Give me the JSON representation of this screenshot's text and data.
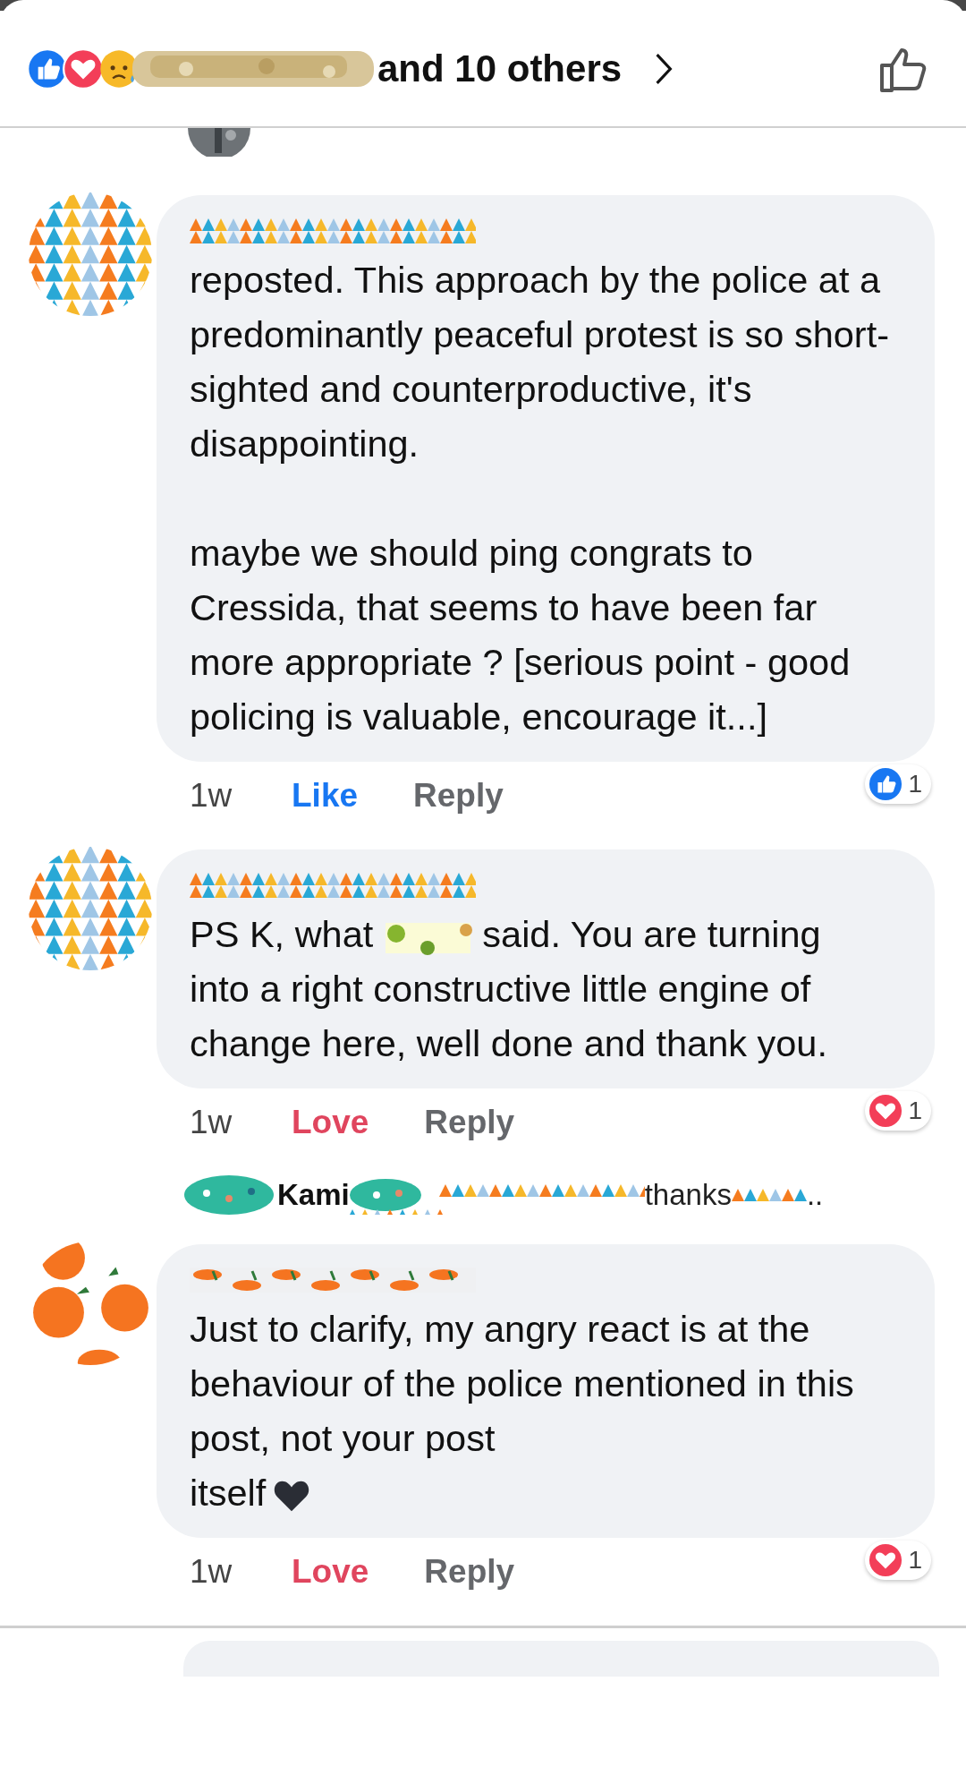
{
  "header": {
    "others_text": "and 10 others"
  },
  "feed": [
    {
      "kind": "comment",
      "paragraphs": [
        [
          {
            "text": "reposted. This approach by the police at a predominantly peaceful protest is so short-sighted and counterproductive, it's disappointing."
          }
        ],
        [
          {
            "text": "maybe we should ping congrats to Cressida, that seems to have been far more appropriate ? [serious point - good policing is valuable, encourage it...]"
          }
        ]
      ],
      "time": "1w",
      "reaction": {
        "kind": "like",
        "label": "Like",
        "count": "1"
      },
      "reply": "Reply"
    },
    {
      "kind": "comment",
      "paragraphs": [
        [
          {
            "text": "PS K, what"
          },
          {
            "kind": "picture"
          },
          {
            "text": "said. You are turning"
          },
          {
            "text": "into a right constructive little engine of change here, well done and thank you."
          }
        ]
      ],
      "time": "1w",
      "reaction": {
        "kind": "love",
        "label": "Love",
        "count": "1"
      },
      "reply": "Reply"
    },
    {
      "kind": "reply_preview",
      "name": "Kami",
      "snippet": "thanks",
      "ending": ".."
    },
    {
      "kind": "comment",
      "paragraphs": [
        [
          {
            "text": "Just to clarify, my angry react is at the behaviour of the police mentioned in this post, not your post"
          },
          {
            "text": "itself"
          },
          {
            "kind": "heart"
          }
        ]
      ],
      "time": "1w",
      "reaction": {
        "kind": "love",
        "label": "Love",
        "count": "1"
      },
      "reply": "Reply"
    }
  ]
}
